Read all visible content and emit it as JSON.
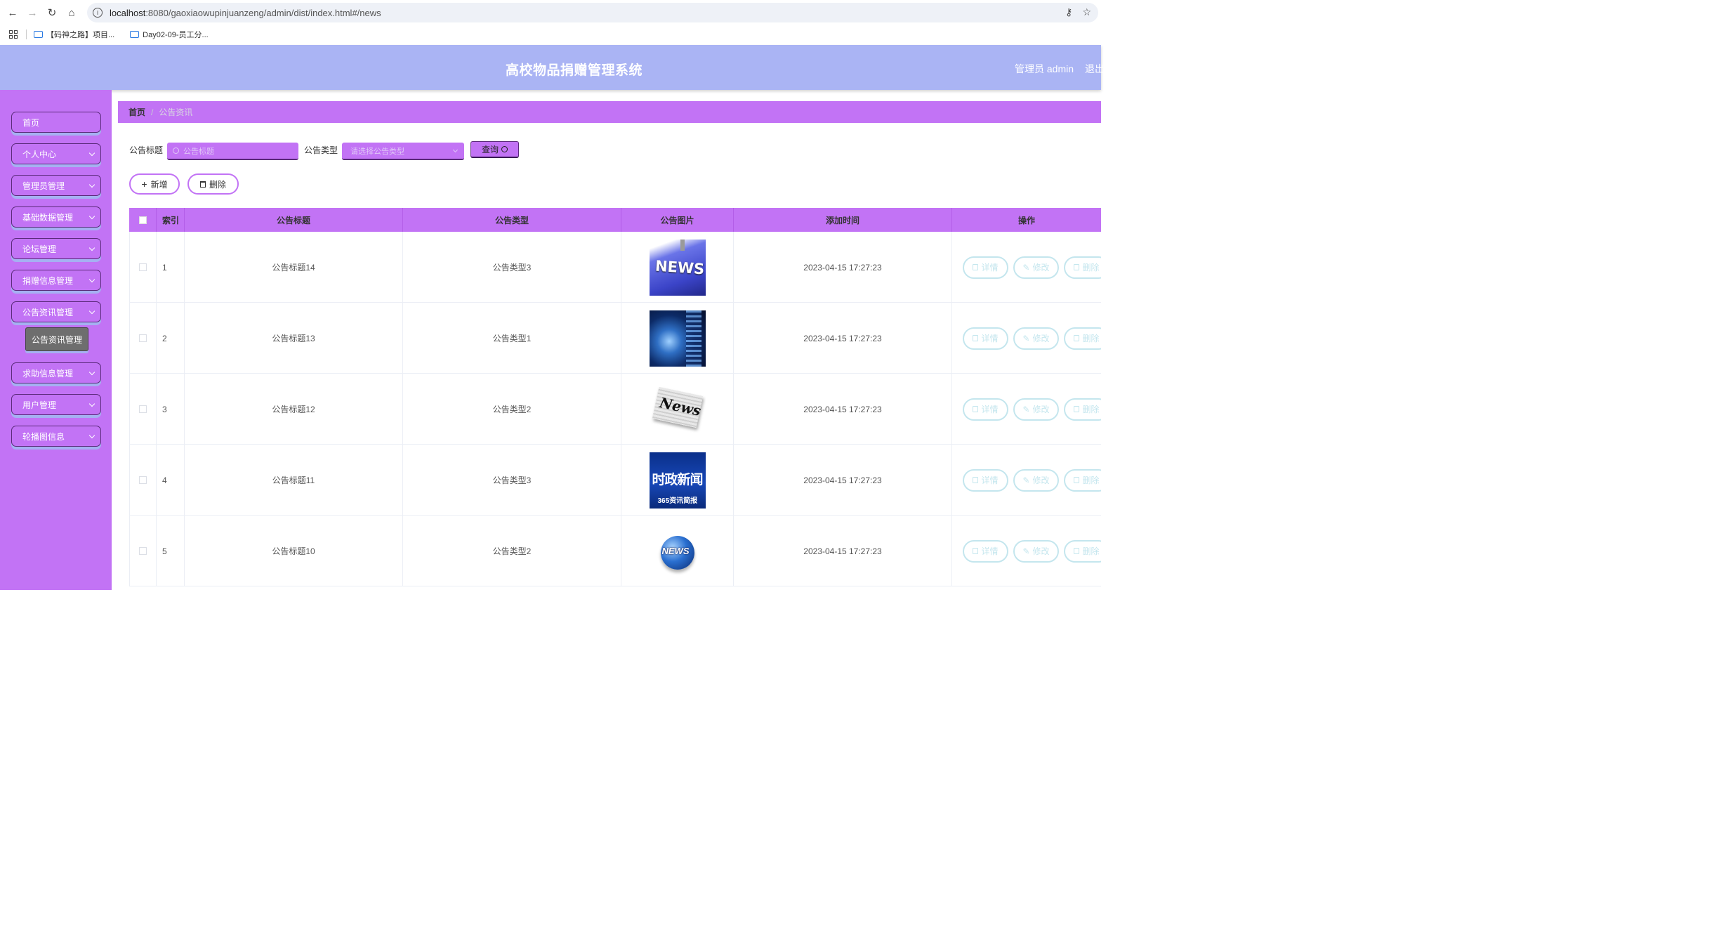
{
  "browser": {
    "url_host": "localhost",
    "url_rest": ":8080/gaoxiaowupinjuanzeng/admin/dist/index.html#/news",
    "bookmarks": [
      "【码神之路】项目...",
      "Day02-09-员工分..."
    ]
  },
  "header": {
    "title": "高校物品捐赠管理系统",
    "admin_label": "管理员 admin",
    "logout_label": "退出"
  },
  "sidebar": {
    "items": [
      {
        "label": "首页",
        "has_children": false
      },
      {
        "label": "个人中心",
        "has_children": true
      },
      {
        "label": "管理员管理",
        "has_children": true
      },
      {
        "label": "基础数据管理",
        "has_children": true
      },
      {
        "label": "论坛管理",
        "has_children": true
      },
      {
        "label": "捐赠信息管理",
        "has_children": true
      },
      {
        "label": "公告资讯管理",
        "has_children": true
      },
      {
        "label": "求助信息管理",
        "has_children": true
      },
      {
        "label": "用户管理",
        "has_children": true
      },
      {
        "label": "轮播图信息",
        "has_children": true
      }
    ],
    "submenu_active": "公告资讯管理"
  },
  "breadcrumb": {
    "home": "首页",
    "separator": "/",
    "current": "公告资讯"
  },
  "search": {
    "title_label": "公告标题",
    "title_placeholder": "公告标题",
    "type_label": "公告类型",
    "type_placeholder": "请选择公告类型",
    "query_label": "查询"
  },
  "actions": {
    "add_label": "新增",
    "delete_label": "删除"
  },
  "table": {
    "headers": [
      "索引",
      "公告标题",
      "公告类型",
      "公告图片",
      "添加时间",
      "操作"
    ],
    "rows": [
      {
        "index": "1",
        "title": "公告标题14",
        "type": "公告类型3",
        "image": "news-keyboard",
        "time": "2023-04-15 17:27:23"
      },
      {
        "index": "2",
        "title": "公告标题13",
        "type": "公告类型1",
        "image": "news-globe-blue",
        "time": "2023-04-15 17:27:23"
      },
      {
        "index": "3",
        "title": "公告标题12",
        "type": "公告类型2",
        "image": "news-paper",
        "time": "2023-04-15 17:27:23"
      },
      {
        "index": "4",
        "title": "公告标题11",
        "type": "公告类型3",
        "image": "political-news",
        "time": "2023-04-15 17:27:23"
      },
      {
        "index": "5",
        "title": "公告标题10",
        "type": "公告类型2",
        "image": "news-globe",
        "time": "2023-04-15 17:27:23"
      }
    ],
    "row_actions": {
      "detail_label": "详情",
      "edit_label": "修改",
      "delete_label": "删除"
    },
    "image_texts": {
      "img1": "NEWS",
      "img3": "News",
      "img4_main": "时政新闻",
      "img4_sub": "365资讯简报",
      "img5": "NEWS"
    }
  },
  "colors": {
    "header_bg": "#aab4f4",
    "accent_purple": "#c273f5",
    "op_button_border": "#c4e6ee"
  }
}
